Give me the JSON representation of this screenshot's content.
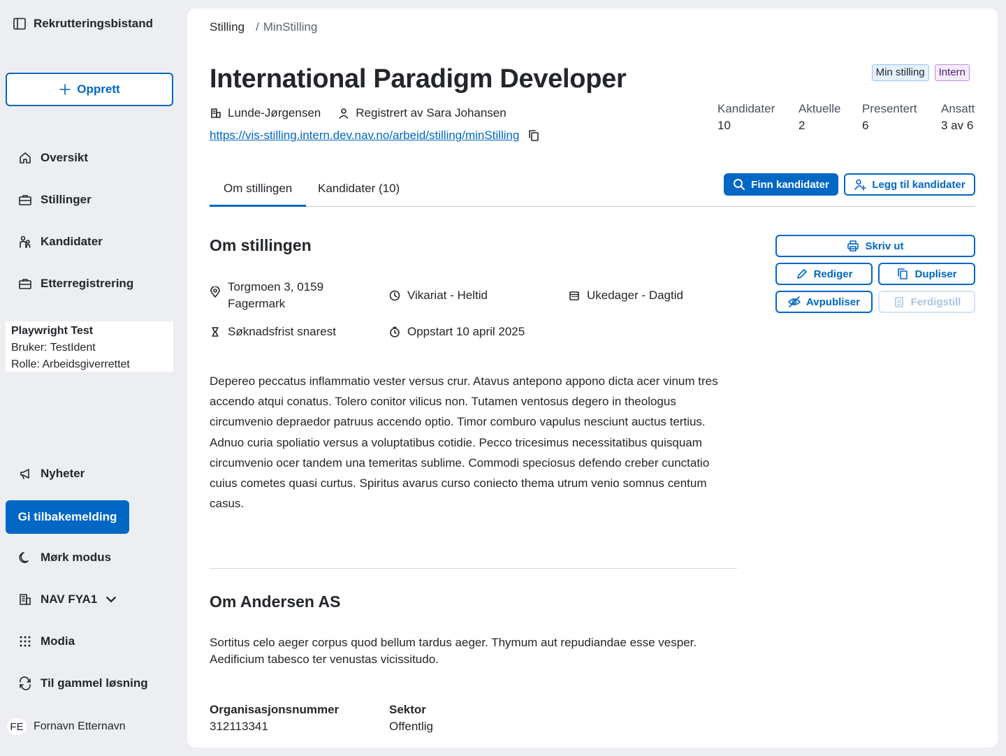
{
  "sidebar": {
    "brand": "Rekrutteringsbistand",
    "create_label": "Opprett",
    "nav": [
      "Oversikt",
      "Stillinger",
      "Kandidater",
      "Etterregistrering"
    ],
    "user": {
      "name": "Playwright Test",
      "user_line": "Bruker: TestIdent",
      "role_line": "Rolle: Arbeidsgiverrettet"
    },
    "news": "Nyheter",
    "feedback": "Gi tilbakemelding",
    "dark_mode": "Mørk modus",
    "office": "NAV FYA1",
    "modia": "Modia",
    "old_solution": "Til gammel løsning",
    "profile_initials": "FE",
    "profile_name": "Fornavn Etternavn"
  },
  "breadcrumb": {
    "root": "Stilling",
    "separator": "/",
    "current": "MinStilling"
  },
  "job": {
    "title": "International Paradigm Developer",
    "employer": "Lunde-Jørgensen",
    "registered_by": "Registrert av Sara Johansen",
    "url": "https://vis-stilling.intern.dev.nav.no/arbeid/stilling/minStilling"
  },
  "tags": [
    "Min stilling",
    "Intern"
  ],
  "stats": [
    {
      "label": "Kandidater",
      "value": "10"
    },
    {
      "label": "Aktuelle",
      "value": "2"
    },
    {
      "label": "Presentert",
      "value": "6"
    },
    {
      "label": "Ansatt",
      "value": "3 av 6"
    }
  ],
  "tabs": [
    "Om stillingen",
    "Kandidater (10)"
  ],
  "actions": {
    "find": "Finn kandidater",
    "add": "Legg til kandidater",
    "print": "Skriv ut",
    "edit": "Rediger",
    "duplicate": "Dupliser",
    "unpublish": "Avpubliser",
    "complete": "Ferdigstill"
  },
  "about_job": {
    "heading": "Om stillingen",
    "address_line1": "Torgmoen 3, 0159",
    "address_line2": "Fagermark",
    "employment": "Vikariat - Heltid",
    "schedule": "Ukedager - Dagtid",
    "deadline": "Søknadsfrist snarest",
    "start": "Oppstart 10 april 2025",
    "description": "Depereo peccatus inflammatio vester versus crur. Atavus antepono appono dicta acer vinum tres accendo atqui conatus. Tolero conitor vilicus non. Tutamen ventosus degero in theologus circumvenio depraedor patruus accendo optio. Timor comburo vapulus nesciunt auctus tertius. Adnuo curia spoliatio versus a voluptatibus cotidie. Pecco tricesimus necessitatibus quisquam circumvenio ocer tandem una temeritas sublime. Commodi speciosus defendo creber cunctatio cuius cometes quasi curtus. Spiritus avarus curso coniecto thema utrum venio somnus centum casus."
  },
  "about_employer": {
    "heading": "Om Andersen AS",
    "description": "Sortitus celo aeger corpus quod bellum tardus aeger. Thymum aut repudiandae esse vesper. Aedificium tabesco ter venustas vicissitudo.",
    "org_label": "Organisasjonsnummer",
    "org_value": "312113341",
    "sector_label": "Sektor",
    "sector_value": "Offentlig"
  }
}
